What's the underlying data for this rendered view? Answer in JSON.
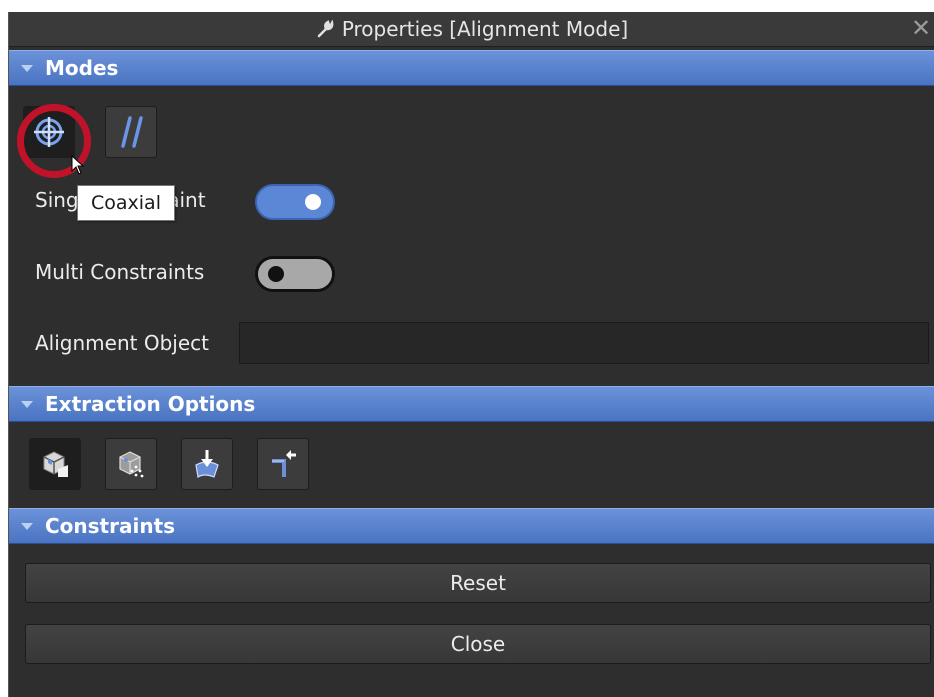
{
  "window": {
    "title": "Properties [Alignment Mode]",
    "title_icon": "wrench-icon",
    "close_label": "✕"
  },
  "modes": {
    "header": "Modes",
    "buttons": [
      {
        "name": "coaxial-mode-button",
        "icon": "crosshair-target-icon",
        "selected": true
      },
      {
        "name": "parallel-mode-button",
        "icon": "parallel-lines-icon",
        "glyph": "//"
      }
    ],
    "tooltip": "Coaxial",
    "single_constraint_label": "Single Constraint",
    "single_constraint_visible_left": "Sing",
    "single_constraint_visible_right": "raint",
    "single_constraint_on": true,
    "multi_constraints_label": "Multi Constraints",
    "multi_constraints_on": false,
    "alignment_object_label": "Alignment Object",
    "alignment_object_value": ""
  },
  "extraction_options": {
    "header": "Extraction Options",
    "buttons": [
      {
        "name": "extract-solid-button",
        "icon": "cube-solid-icon",
        "selected": true
      },
      {
        "name": "extract-points-button",
        "icon": "cube-points-icon"
      },
      {
        "name": "extract-surface-button",
        "icon": "surface-arrow-icon"
      },
      {
        "name": "extract-edge-button",
        "icon": "edge-arrow-icon"
      }
    ]
  },
  "constraints": {
    "header": "Constraints",
    "reset_label": "Reset",
    "close_label": "Close"
  },
  "colors": {
    "panel_bg": "#2e2e2e",
    "header_blue": "#5a82cf",
    "toggle_on": "#5c86d6",
    "highlight_ring": "#c0132a"
  }
}
